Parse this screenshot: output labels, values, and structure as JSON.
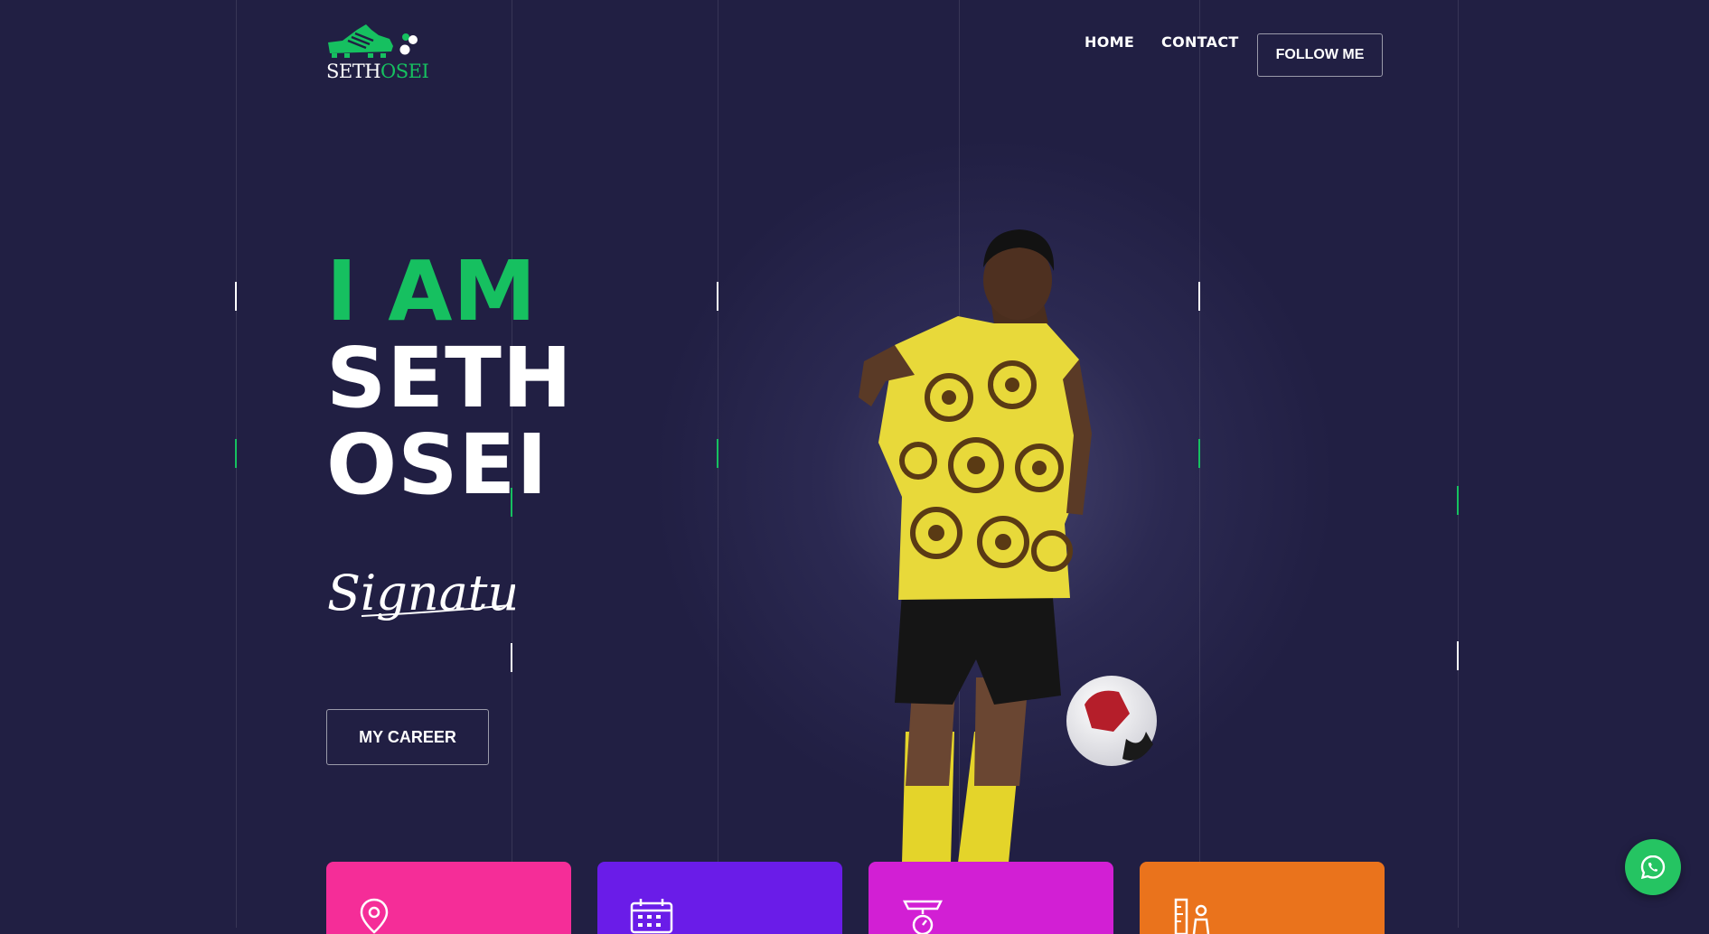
{
  "logo": {
    "first": "SETH",
    "last": "OSEI",
    "icon": "football-boot-icon"
  },
  "nav": {
    "home": "HOME",
    "contact": "CONTACT",
    "follow": "FOLLOW ME"
  },
  "hero": {
    "line1": "I AM",
    "line2": "SETH",
    "line3": "OSEI",
    "signature": "Signature",
    "career_button": "MY CAREER"
  },
  "cards": [
    {
      "icon": "location-pin-icon",
      "color": "#f52d98"
    },
    {
      "icon": "calendar-icon",
      "color": "#6a1ce8"
    },
    {
      "icon": "weighing-scale-icon",
      "color": "#d21fd4"
    },
    {
      "icon": "height-ruler-icon",
      "color": "#ea731c"
    }
  ],
  "whatsapp": {
    "icon": "whatsapp-icon"
  },
  "colors": {
    "background": "#211f43",
    "accent": "#16c060"
  }
}
